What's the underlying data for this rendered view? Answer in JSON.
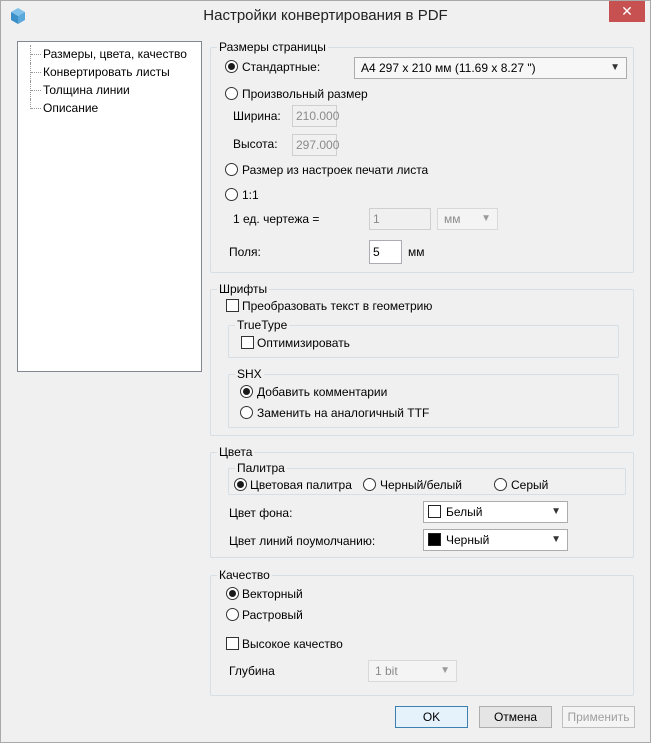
{
  "window": {
    "title": "Настройки конвертирования в PDF",
    "close_label": "✕"
  },
  "nav": {
    "items": [
      {
        "label": "Размеры, цвета, качество"
      },
      {
        "label": "Конвертировать листы"
      },
      {
        "label": "Толщина линии"
      },
      {
        "label": "Описание"
      }
    ]
  },
  "page_size": {
    "group_title": "Размеры страницы",
    "standard_label": "Стандартные:",
    "standard_value": "A4 297 x 210 мм (11.69 x 8.27 \")",
    "custom_label": "Произвольный размер",
    "width_label": "Ширина:",
    "width_value": "210.000",
    "height_label": "Высота:",
    "height_value": "297.000",
    "from_sheet_label": "Размер из настроек печати листа",
    "scale_label": "1:1",
    "unit_label": "1 ед. чертежа =",
    "unit_value": "1",
    "unit_select": "мм",
    "margins_label": "Поля:",
    "margins_value": "5",
    "margins_unit": "мм"
  },
  "fonts": {
    "group_title": "Шрифты",
    "convert_text_label": "Преобразовать текст в геометрию",
    "truetype_title": "TrueType",
    "optimize_label": "Оптимизировать",
    "shx_title": "SHX",
    "add_comments_label": "Добавить комментарии",
    "replace_ttf_label": "Заменить на аналогичный TTF"
  },
  "colors": {
    "group_title": "Цвета",
    "palette_title": "Палитра",
    "color_palette_label": "Цветовая палитра",
    "bw_label": "Черный/белый",
    "gray_label": "Серый",
    "bg_label": "Цвет фона:",
    "bg_value": "Белый",
    "bg_swatch": "#ffffff",
    "line_label": "Цвет линий поумолчанию:",
    "line_value": "Черный",
    "line_swatch": "#000000"
  },
  "quality": {
    "group_title": "Качество",
    "vector_label": "Векторный",
    "raster_label": "Растровый",
    "high_quality_label": "Высокое качество",
    "depth_label": "Глубина",
    "depth_value": "1 bit"
  },
  "buttons": {
    "ok": "OK",
    "cancel": "Отмена",
    "apply": "Применить"
  }
}
